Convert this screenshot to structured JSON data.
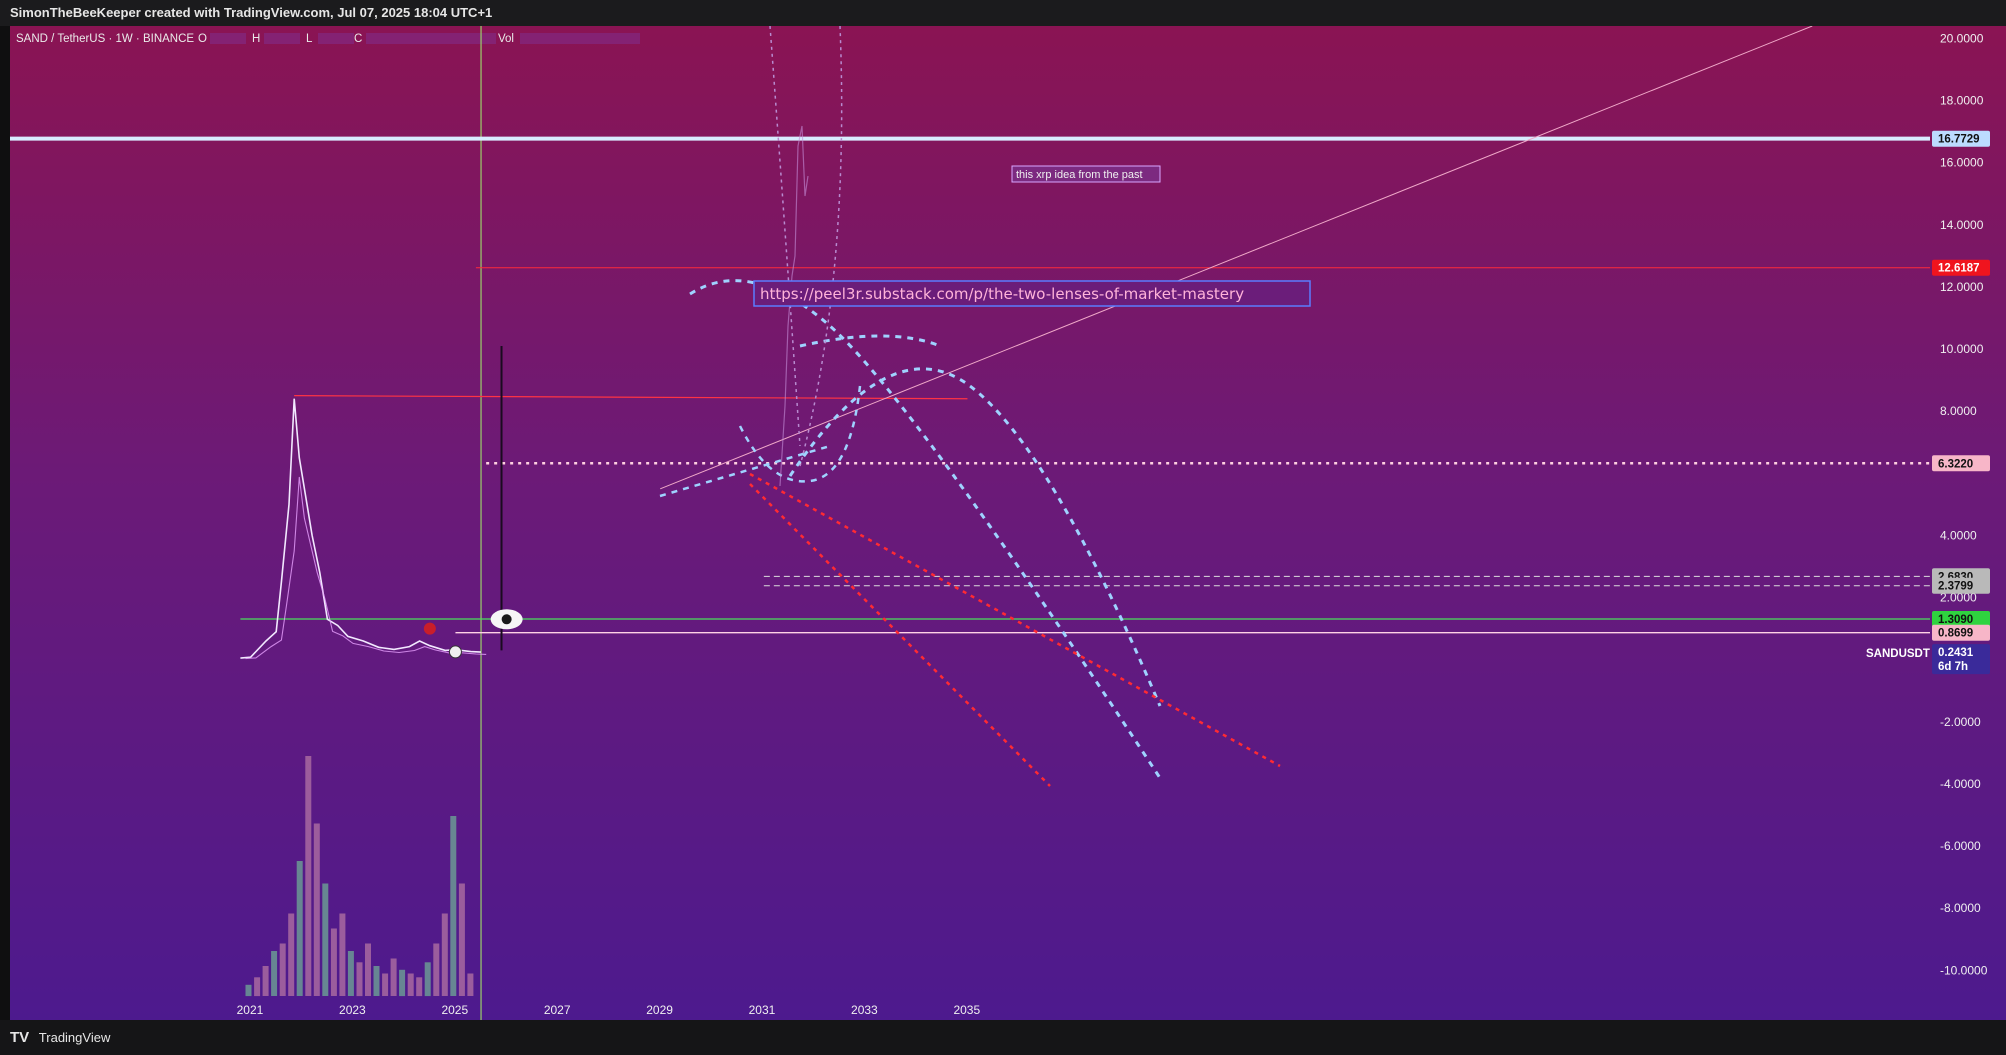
{
  "header": {
    "title": "SimonTheBeeKeeper created with TradingView.com, Jul 07, 2025 18:04 UTC+1"
  },
  "legend": {
    "symbol": "SAND / TetherUS · 1W · BINANCE",
    "o_label": "O",
    "h_label": "H",
    "l_label": "L",
    "c_label": "C",
    "vol_label": "Vol"
  },
  "footer": {
    "brand": "TradingView"
  },
  "annotations": {
    "idea_note": "this xrp idea from the past",
    "url": "https://peel3r.substack.com/p/the-two-lenses-of-market-mastery"
  },
  "chart_data": {
    "type": "line",
    "symbol": "SANDUSDT",
    "x_ticks": [
      "2021",
      "2023",
      "2025",
      "2027",
      "2029",
      "2031",
      "2033",
      "2035"
    ],
    "y_ticks": [
      "20.0000",
      "18.0000",
      "16.0000",
      "14.0000",
      "12.0000",
      "10.0000",
      "8.0000",
      "4.0000",
      "2.0000",
      "-2.0000",
      "-4.0000",
      "-6.0000",
      "-8.0000",
      "-10.0000"
    ],
    "y_range": [
      -11.6,
      20.4
    ],
    "x_range": [
      2016.3,
      2053.8
    ],
    "price_labels": [
      {
        "value": 16.7729,
        "text": "16.7729",
        "bg": "#bcdcff",
        "fg": "#111111"
      },
      {
        "value": 12.6187,
        "text": "12.6187",
        "bg": "#f0141e",
        "fg": "#ffffff"
      },
      {
        "value": 6.322,
        "text": "6.3220",
        "bg": "#f7b6c8",
        "fg": "#111111"
      },
      {
        "value": 2.683,
        "text": "2.6830",
        "bg": "#b9b9b9",
        "fg": "#111111"
      },
      {
        "value": 2.3799,
        "text": "2.3799",
        "bg": "#b9b9b9",
        "fg": "#111111"
      },
      {
        "value": 1.309,
        "text": "1.3090",
        "bg": "#2fd33f",
        "fg": "#111111"
      },
      {
        "value": 0.8699,
        "text": "0.8699",
        "bg": "#f7b6c8",
        "fg": "#111111"
      }
    ],
    "last_price": {
      "symbol": "SANDUSDT",
      "value": 0.2431,
      "text": "0.2431",
      "countdown": "6d 7h"
    },
    "price_series": [
      [
        2020.8,
        0.05
      ],
      [
        2021.0,
        0.08
      ],
      [
        2021.3,
        0.6
      ],
      [
        2021.5,
        0.9
      ],
      [
        2021.6,
        2.5
      ],
      [
        2021.75,
        5.0
      ],
      [
        2021.85,
        8.4
      ],
      [
        2021.95,
        6.5
      ],
      [
        2022.1,
        5.0
      ],
      [
        2022.2,
        4.0
      ],
      [
        2022.35,
        2.8
      ],
      [
        2022.5,
        1.3
      ],
      [
        2022.7,
        1.1
      ],
      [
        2022.9,
        0.75
      ],
      [
        2023.2,
        0.6
      ],
      [
        2023.5,
        0.4
      ],
      [
        2023.8,
        0.33
      ],
      [
        2024.1,
        0.42
      ],
      [
        2024.3,
        0.6
      ],
      [
        2024.5,
        0.45
      ],
      [
        2024.8,
        0.3
      ],
      [
        2025.0,
        0.32
      ],
      [
        2025.3,
        0.26
      ],
      [
        2025.5,
        0.2431
      ]
    ],
    "volume_series": [
      3,
      5,
      8,
      12,
      14,
      22,
      36,
      64,
      46,
      30,
      18,
      22,
      12,
      9,
      14,
      8,
      6,
      10,
      7,
      6,
      5,
      9,
      14,
      22,
      48,
      30,
      6
    ]
  }
}
